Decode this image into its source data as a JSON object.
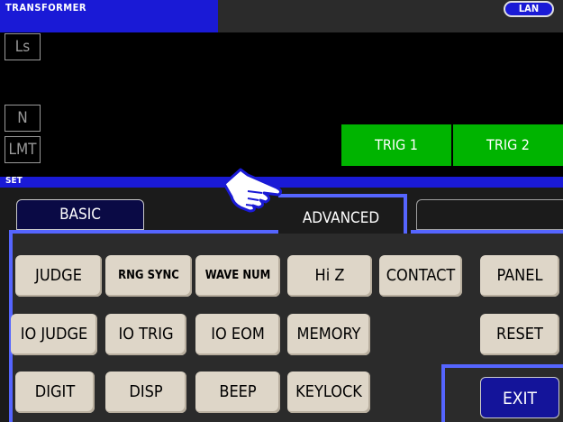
{
  "header": {
    "title": "TRANSFORMER",
    "lan_label": "LAN"
  },
  "measurement": {
    "params": [
      "Ls",
      "N",
      "LMT"
    ],
    "trig_buttons": [
      "TRIG 1",
      "TRIG 2"
    ]
  },
  "set_label": "SET",
  "tabs": {
    "basic": "BASIC",
    "advanced": "ADVANCED"
  },
  "buttons": {
    "row1": [
      "JUDGE",
      "RNG SYNC",
      "WAVE NUM",
      "Hi Z",
      "CONTACT",
      "PANEL"
    ],
    "row2": [
      "IO JUDGE",
      "IO TRIG",
      "IO EOM",
      "MEMORY",
      "RESET"
    ],
    "row3": [
      "DIGIT",
      "DISP",
      "BEEP",
      "KEYLOCK"
    ],
    "exit": "EXIT"
  },
  "icons": {
    "pointer": "pointing-hand-icon"
  },
  "colors": {
    "accent_blue": "#1a1ad6",
    "trigger_green": "#00b400",
    "highlight_border": "#5565ff",
    "button_face": "#ded6c8"
  }
}
